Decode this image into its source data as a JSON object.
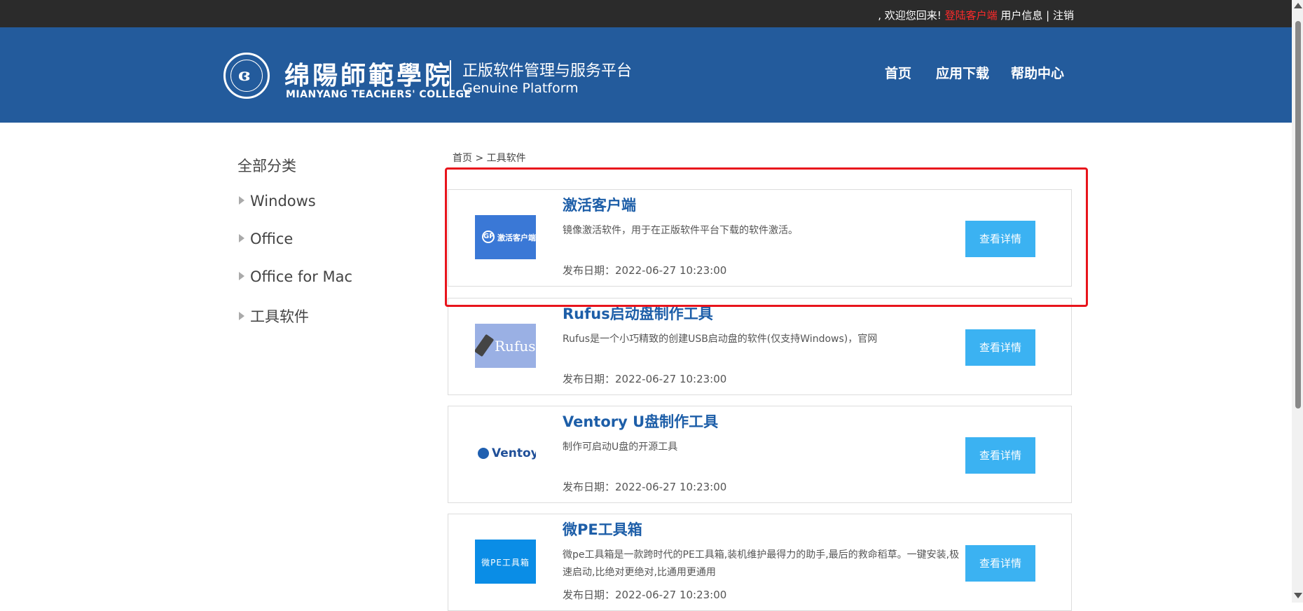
{
  "topbar": {
    "welcome": ", 欢迎您回来! ",
    "login_client": "登陆客户端",
    "user_info": "用户信息",
    "sep": " | ",
    "logout": "注销"
  },
  "header": {
    "college_cn": "绵陽師範學院",
    "college_en": "MIANYANG TEACHERS' COLLEGE",
    "platform_cn": "正版软件管理与服务平台",
    "platform_en": "Genuine Platform",
    "nav": [
      "首页",
      "应用下载",
      "帮助中心"
    ]
  },
  "sidebar": {
    "title": "全部分类",
    "items": [
      "Windows",
      "Office",
      "Office for Mac",
      "工具软件"
    ]
  },
  "breadcrumb": {
    "home": "首页",
    "sep": " > ",
    "current": "工具软件"
  },
  "cards": [
    {
      "name": "激活客户端",
      "desc": "镜像激活软件，用于在正版软件平台下载的软件激活。",
      "date": "发布日期：2022-06-27 10:23:00",
      "button": "查看详情",
      "thumb_text": "激活客户端",
      "thumb_mark": "GP"
    },
    {
      "name": "Rufus启动盘制作工具",
      "desc": "Rufus是一个小巧精致的创建USB启动盘的软件(仅支持Windows)，官网",
      "date": "发布日期：2022-06-27 10:23:00",
      "button": "查看详情",
      "thumb_text": "Rufus"
    },
    {
      "name": "Ventory U盘制作工具",
      "desc": "制作可启动U盘的开源工具",
      "date": "发布日期：2022-06-27 10:23:00",
      "button": "查看详情",
      "thumb_text": "Ventoy"
    },
    {
      "name": "微PE工具箱",
      "desc": "微pe工具箱是一款跨时代的PE工具箱,装机维护最得力的助手,最后的救命稻草。一键安装,极速启动,比绝对更绝对,比通用更通用",
      "date": "发布日期：2022-06-27 10:23:00",
      "button": "查看详情",
      "thumb_text": "微PE工具箱"
    }
  ],
  "colors": {
    "header_bg": "#235b9c",
    "topbar_bg": "#2b2b2b",
    "accent_button": "#3bb2f2",
    "title_link": "#1d5ea8",
    "highlight": "#e8141c",
    "login_link": "#ff2a2a"
  }
}
